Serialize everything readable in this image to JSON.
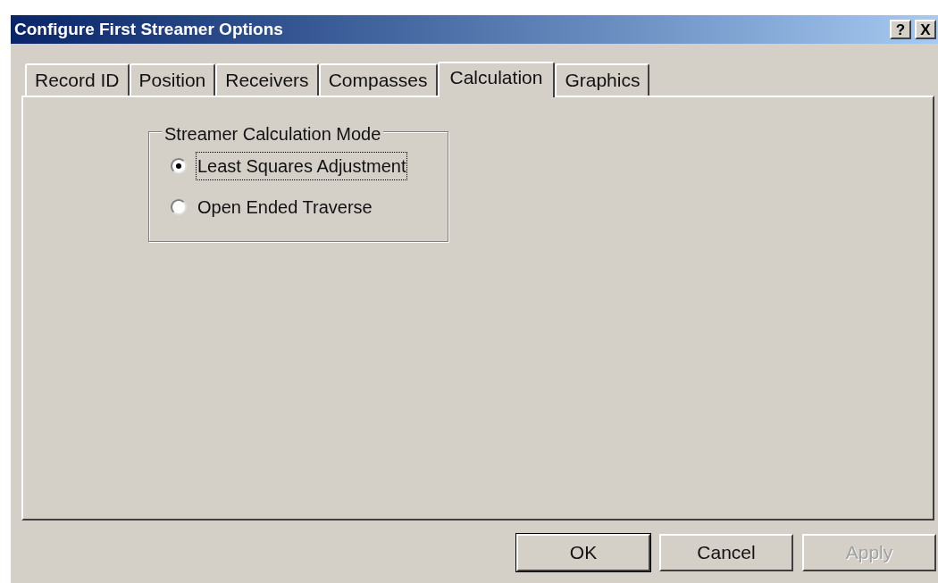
{
  "window": {
    "title": "Configure First Streamer Options",
    "title_buttons": [
      {
        "kind": "help",
        "label": "?"
      },
      {
        "kind": "close",
        "label": "X"
      }
    ]
  },
  "tabs": [
    {
      "label": "Record ID",
      "selected": false
    },
    {
      "label": "Position",
      "selected": false
    },
    {
      "label": "Receivers",
      "selected": false
    },
    {
      "label": "Compasses",
      "selected": false
    },
    {
      "label": "Calculation",
      "selected": true
    },
    {
      "label": "Graphics",
      "selected": false
    }
  ],
  "group": {
    "title": "Streamer Calculation Mode",
    "options": [
      {
        "label": "Least Squares Adjustment",
        "selected": true,
        "focused": true
      },
      {
        "label": "Open Ended Traverse",
        "selected": false,
        "focused": false
      }
    ]
  },
  "buttons": [
    {
      "label": "OK",
      "default": true,
      "disabled": false
    },
    {
      "label": "Cancel",
      "default": false,
      "disabled": false
    },
    {
      "label": "Apply",
      "default": false,
      "disabled": true
    }
  ]
}
